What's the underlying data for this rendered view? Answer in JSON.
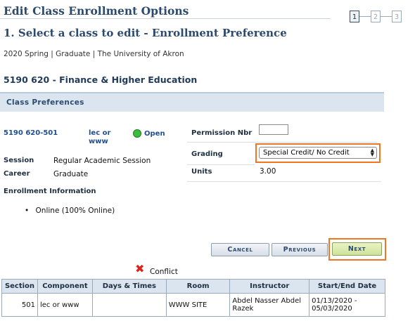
{
  "page": {
    "title": "Edit Class Enrollment Options",
    "subtitle": "1.  Select a class to edit - Enrollment Preference",
    "context": "2020 Spring | Graduate | The University of Akron",
    "class_heading": "5190  620 - Finance & Higher Education"
  },
  "steps": {
    "items": [
      "1",
      "2",
      "3"
    ],
    "current": 1
  },
  "preferences": {
    "section_title": "Class Preferences",
    "class_link": "5190  620-501",
    "component_link": "lec or www",
    "status": "Open",
    "session_label": "Session",
    "session_value": "Regular Academic Session",
    "career_label": "Career",
    "career_value": "Graduate",
    "enrollment_info_label": "Enrollment Information",
    "enrollment_info_item": "Online (100% Online)",
    "permission_label": "Permission Nbr",
    "permission_value": "",
    "grading_label": "Grading",
    "grading_value": "Special Credit/ No Credit",
    "units_label": "Units",
    "units_value": "3.00"
  },
  "buttons": {
    "cancel": "Cancel",
    "previous": "Previous",
    "next": "Next"
  },
  "conflict": {
    "label": "Conflict"
  },
  "table": {
    "headers": [
      "Section",
      "Component",
      "Days & Times",
      "Room",
      "Instructor",
      "Start/End Date"
    ],
    "rows": [
      {
        "section": "501",
        "component": "lec or www",
        "days_times": "",
        "room": "WWW SITE",
        "instructor": "Abdel Nasser Abdel Razek",
        "dates": "01/13/2020 - 05/03/2020"
      }
    ]
  },
  "colors": {
    "highlight": "#f07623",
    "header_bg": "#dbe5f0",
    "title": "#2c4a6e",
    "status_open": "#3bbd3b"
  }
}
